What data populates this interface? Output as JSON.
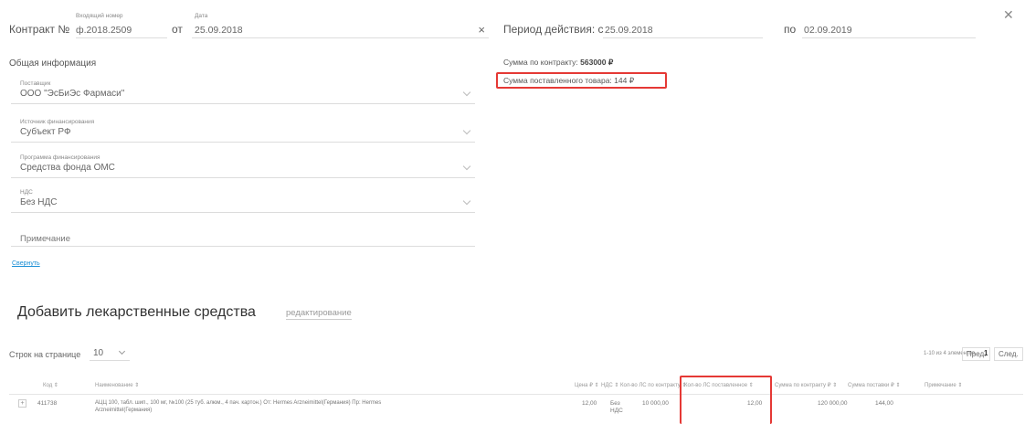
{
  "contract": {
    "label": "Контракт №",
    "number_label": "Входящий номер",
    "number_value": "ф.2018.2509",
    "from_label": "от",
    "date_label": "Дата",
    "date_value": "25.09.2018",
    "clear_glyph": "×"
  },
  "period": {
    "label": "Период действия: с",
    "start": "25.09.2018",
    "to_label": "по",
    "end": "02.09.2019"
  },
  "close_glyph": "✕",
  "general_info_title": "Общая информация",
  "summary": {
    "contract_sum_label": "Сумма по контракту:",
    "contract_sum_value": "563000 ₽",
    "delivered_label": "Сумма поставленного товара: 144 ₽"
  },
  "fields": {
    "supplier": {
      "label": "Поставщик",
      "value": "ООО \"ЭсБиЭс Фармаси\""
    },
    "funding_source": {
      "label": "Источник финансирования",
      "value": "Субъект РФ"
    },
    "program": {
      "label": "Программа финансирования",
      "value": "Средства фонда ОМС"
    },
    "vat": {
      "label": "НДС",
      "value": "Без НДС"
    },
    "note_placeholder": "Примечание"
  },
  "collapse_link": "Свернуть",
  "drugs": {
    "title": "Добавить лекарственные средства",
    "edit_link": "редактирование"
  },
  "pagination": {
    "rows_label": "Строк на странице",
    "rows_value": "10",
    "info": "1-10 из 4 элементов",
    "prev": "Пред.",
    "page": "1",
    "next": "След."
  },
  "table": {
    "headers": {
      "code": "Код ⇕",
      "name": "Наименование ⇕",
      "price": "Цена ₽ ⇕",
      "vat": "НДС ⇕",
      "qty_contract": "Кол-во ЛС по контракту ⇕",
      "qty_delivered": "Кол-во ЛС поставленное ⇕",
      "sum_contract": "Сумма по контракту ₽ ⇕",
      "sum_delivered": "Сумма поставки ₽ ⇕",
      "note": "Примечание ⇕"
    },
    "rows": [
      {
        "expand": "+",
        "code": "411738",
        "name_line1": "АЦЦ 100, табл. шип., 100 мг, №100 (25 туб. алюм., 4 пач. картон.) От: Hermes Arzneimittel(Германия) Пр: Hermes",
        "name_line2": "Arzneimittel(Германия)",
        "price": "12,00",
        "vat_line1": "Без",
        "vat_line2": "НДС",
        "qty_contract": "10 000,00",
        "qty_delivered": "12,00",
        "sum_contract": "120 000,00",
        "sum_delivered": "144,00"
      }
    ]
  },
  "colors": {
    "highlight": "#e53935",
    "link": "#1e90d6"
  }
}
